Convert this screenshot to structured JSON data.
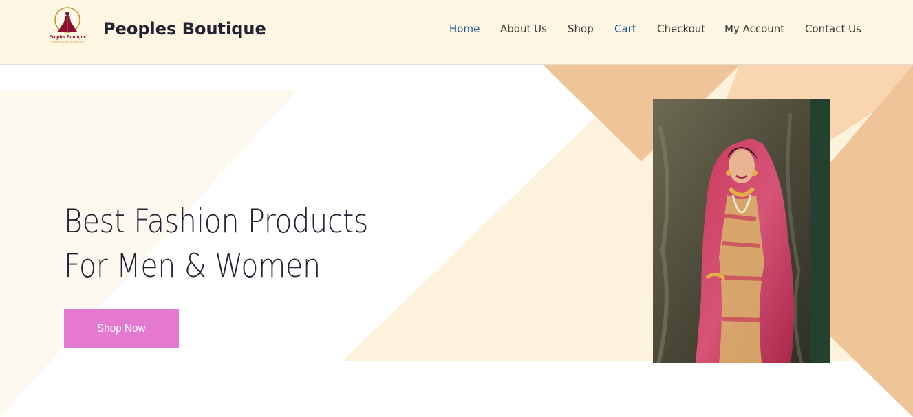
{
  "header": {
    "brand": "Peoples Boutique",
    "logo": {
      "icon": "boutique-dress-logo-icon",
      "text_top": "Peoples Boutique",
      "text_bottom": "Fashion Design & Collection"
    }
  },
  "nav": {
    "items": [
      {
        "label": "Home",
        "active": true
      },
      {
        "label": "About Us",
        "active": false
      },
      {
        "label": "Shop",
        "active": false
      },
      {
        "label": "Cart",
        "active": true
      },
      {
        "label": "Checkout",
        "active": false
      },
      {
        "label": "My Account",
        "active": false
      },
      {
        "label": "Contact Us",
        "active": false
      }
    ]
  },
  "hero": {
    "headline_line1": "Best Fashion Products",
    "headline_line2": "For Men & Women",
    "cta_label": "Shop Now",
    "image": "bride-red-saree-photo"
  },
  "colors": {
    "header_bg": "#fdf6e3",
    "nav_active": "#1e5a92",
    "cta_bg": "#e578cf",
    "accent_peach": "#efc498",
    "accent_cream": "#fdf3dc"
  }
}
